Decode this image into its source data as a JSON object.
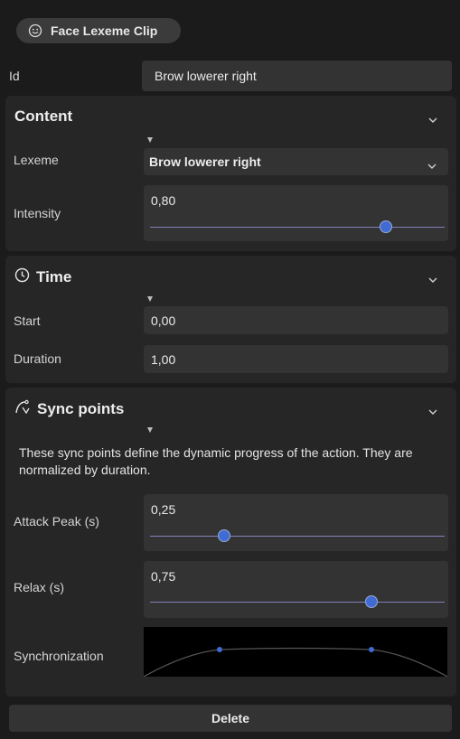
{
  "header": {
    "title": "Face Lexeme Clip",
    "icon": "smiley-icon"
  },
  "id_row": {
    "label": "Id",
    "value": "Brow lowerer right"
  },
  "content": {
    "title": "Content",
    "lexeme_label": "Lexeme",
    "lexeme_value": "Brow lowerer right",
    "intensity_label": "Intensity",
    "intensity_value": "0,80",
    "intensity_fraction": 0.8
  },
  "time": {
    "title": "Time",
    "icon": "clock-icon",
    "start_label": "Start",
    "start_value": "0,00",
    "duration_label": "Duration",
    "duration_value": "1,00"
  },
  "sync": {
    "title": "Sync points",
    "icon": "sync-curve-icon",
    "description": "These sync points define the dynamic progress of the action. They are normalized by duration.",
    "attack_label": "Attack Peak (s)",
    "attack_value": "0,25",
    "attack_fraction": 0.25,
    "relax_label": "Relax (s)",
    "relax_value": "0,75",
    "relax_fraction": 0.75,
    "sync_label": "Synchronization"
  },
  "delete_label": "Delete",
  "colors": {
    "accent": "#3f6bd3",
    "panel": "#262626",
    "field": "#333333",
    "background": "#1b1b1b"
  }
}
